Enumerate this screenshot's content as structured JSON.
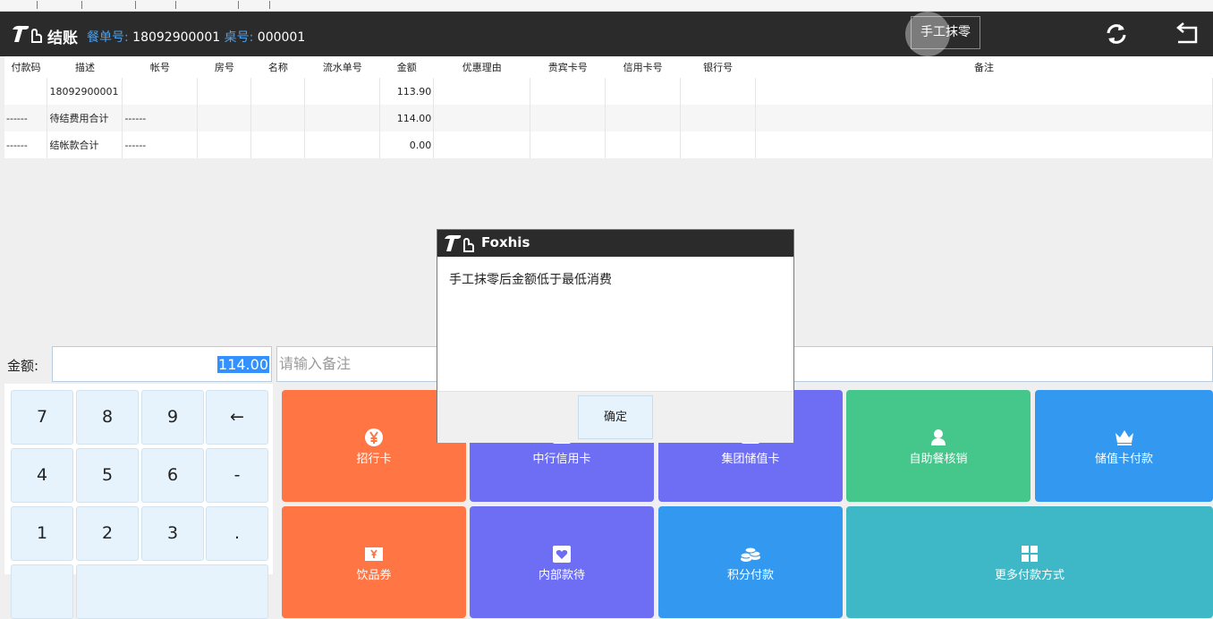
{
  "header": {
    "title": "结账",
    "order_label": "餐单号:",
    "order_no": "18092900001",
    "table_label": "桌号:",
    "table_no": "000001",
    "manual_round_button": "手工抹零",
    "icons": [
      "refresh-icon",
      "return-icon"
    ]
  },
  "table": {
    "columns": [
      "付款码",
      "描述",
      "帐号",
      "房号",
      "名称",
      "流水单号",
      "金额",
      "优惠理由",
      "贵宾卡号",
      "信用卡号",
      "银行号",
      "备注"
    ],
    "rows": [
      [
        "",
        "18092900001",
        "",
        "",
        "",
        "",
        "113.90",
        "",
        "",
        "",
        "",
        ""
      ],
      [
        "------",
        "待结费用合计",
        "------",
        "",
        "",
        "",
        "114.00",
        "",
        "",
        "",
        "",
        ""
      ],
      [
        "------",
        "结帐款合计",
        "------",
        "",
        "",
        "",
        "0.00",
        "",
        "",
        "",
        "",
        ""
      ]
    ]
  },
  "amount": {
    "label": "金额:",
    "value": "114.00"
  },
  "remark": {
    "placeholder": "请输入备注"
  },
  "keypad": [
    "7",
    "8",
    "9",
    "←",
    "4",
    "5",
    "6",
    "-",
    "1",
    "2",
    "3",
    "."
  ],
  "payments": [
    {
      "label": "招行卡",
      "icon": "yen-icon",
      "color": "#ff7544"
    },
    {
      "label": "中行信用卡",
      "icon": "card-icon",
      "color": "#6e6ef5"
    },
    {
      "label": "集团储值卡",
      "icon": "card-icon",
      "color": "#6e6ef5"
    },
    {
      "label": "自助餐核销",
      "icon": "person-icon",
      "color": "#45c68a"
    },
    {
      "label": "储值卡付款",
      "icon": "crown-icon",
      "color": "#3399f0"
    },
    {
      "label": "饮品券",
      "icon": "coupon-icon",
      "color": "#ff7544"
    },
    {
      "label": "内部款待",
      "icon": "heart-box-icon",
      "color": "#6e6ef5"
    },
    {
      "label": "积分付款",
      "icon": "coins-icon",
      "color": "#3399f0"
    },
    {
      "label": "更多付款方式",
      "icon": "grid-icon",
      "color": "#3eb8c6"
    }
  ],
  "dialog": {
    "title": "Foxhis",
    "message": "手工抹零后金额低于最低消费",
    "ok_button": "确定"
  }
}
